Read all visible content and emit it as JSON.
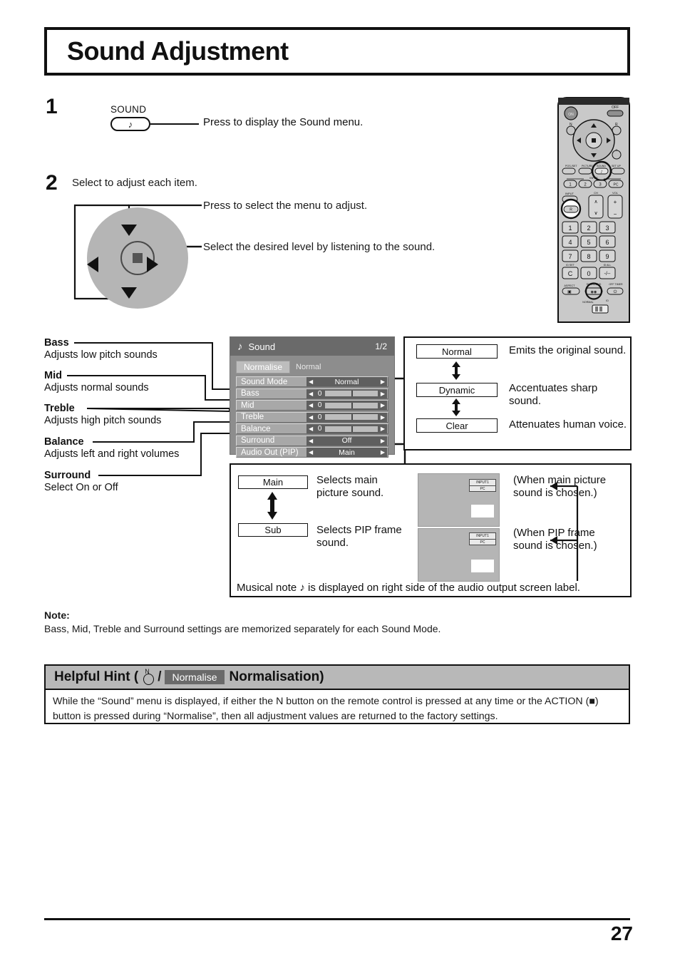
{
  "page": {
    "title": "Sound Adjustment",
    "number": "27"
  },
  "steps": [
    {
      "number": "1",
      "button_label": "SOUND",
      "button_icon": "musical-note-icon",
      "caption": "Press to display the Sound menu."
    },
    {
      "number": "2",
      "heading": "Select to adjust each item.",
      "caption_up_down": "Press to select the menu to adjust.",
      "caption_left_right": "Select the desired level by listening to the sound."
    }
  ],
  "callouts": [
    {
      "title": "Bass",
      "desc": "Adjusts low pitch sounds"
    },
    {
      "title": "Mid",
      "desc": "Adjusts normal sounds"
    },
    {
      "title": "Treble",
      "desc": "Adjusts high pitch sounds"
    },
    {
      "title": "Balance",
      "desc": "Adjusts left and right volumes"
    },
    {
      "title": "Surround",
      "desc": "Select On or Off"
    }
  ],
  "osd": {
    "icon": "musical-note-icon",
    "title": "Sound",
    "page_indicator": "1/2",
    "normalise_label": "Normalise",
    "normalise_value": "Normal",
    "arrow_left": "◀",
    "arrow_right": "▶",
    "rows": [
      {
        "label": "Sound Mode",
        "type": "value",
        "value": "Normal"
      },
      {
        "label": "Bass",
        "type": "slider",
        "value": "0"
      },
      {
        "label": "Mid",
        "type": "slider",
        "value": "0"
      },
      {
        "label": "Treble",
        "type": "slider",
        "value": "0"
      },
      {
        "label": "Balance",
        "type": "slider",
        "value": "0"
      },
      {
        "label": "Surround",
        "type": "value",
        "value": "Off"
      },
      {
        "label": "Audio Out (PIP)",
        "type": "value",
        "value": "Main"
      }
    ]
  },
  "sound_mode_box": {
    "options": [
      {
        "name": "Normal",
        "desc": "Emits the original sound."
      },
      {
        "name": "Dynamic",
        "desc": "Accentuates sharp\nsound."
      },
      {
        "name": "Clear",
        "desc": "Attenuates human voice."
      }
    ],
    "option1": "Normal",
    "option2": "Dynamic",
    "option3": "Clear",
    "desc1": "Emits the original sound.",
    "desc2_line1": "Accentuates sharp",
    "desc2_line2": "sound.",
    "desc3": "Attenuates human voice."
  },
  "pip_box": {
    "option1": "Main",
    "option2": "Sub",
    "desc1_line1": "Selects main",
    "desc1_line2": "picture sound.",
    "desc2_line1": "Selects PIP frame",
    "desc2_line2": "sound.",
    "note1_line1": "(When main picture",
    "note1_line2": "sound is chosen.)",
    "note2_line1": "(When PIP frame",
    "note2_line2": "sound is chosen.)",
    "screen_label_top": "INPUT1",
    "screen_label_bottom": "PC",
    "footer": "Musical note ♪ is displayed on right side of the audio output screen label."
  },
  "note": {
    "title": "Note:",
    "text": "Bass, Mid, Treble and Surround settings are memorized separately for each Sound Mode."
  },
  "helpful_hint": {
    "title_prefix": "Helpful Hint (",
    "n_button_label": "N",
    "slash": "/",
    "normalise_chip": "Normalise",
    "title_suffix": "Normalisation)",
    "body": "While the “Sound” menu is displayed, if either the N button on the remote control is pressed at any time or the ACTION (■) button is pressed during “Normalise”, then all adjustment values are returned to the factory settings."
  },
  "remote": {
    "on_label": "ON",
    "off_label": "OFF",
    "n_label": "N",
    "r_label": "R",
    "pos_size_label": "POS./SET",
    "picture_label": "PICTURE",
    "sound_label": "SOUND",
    "setup_label": "SET UP",
    "input_label": "INPUT",
    "input_buttons": [
      "1",
      "2",
      "3",
      "PC"
    ],
    "input_bottom_label": "INPUT",
    "ch_label": "CH",
    "vol_label": "VOL",
    "keys": [
      "1",
      "2",
      "3",
      "4",
      "5",
      "6",
      "7",
      "8",
      "9",
      "C",
      "0",
      "-/--"
    ],
    "id_set_label": "ID SET",
    "id_all_label": "ID ALL",
    "aspect_label": "ASPECT",
    "surround_label": "SURROUND",
    "off_timer_label": "OFF TIMER",
    "normal_label": "NORMAL",
    "id_label": "ID"
  },
  "colors": {
    "osd_bg": "#8d8d8d",
    "osd_header": "#6a6a6a",
    "osd_row": "#a8a8a8",
    "osd_control": "#5f6060",
    "pad_gray": "#b5b5b5",
    "hint_header": "#b8b8b8",
    "ink": "#111111"
  }
}
